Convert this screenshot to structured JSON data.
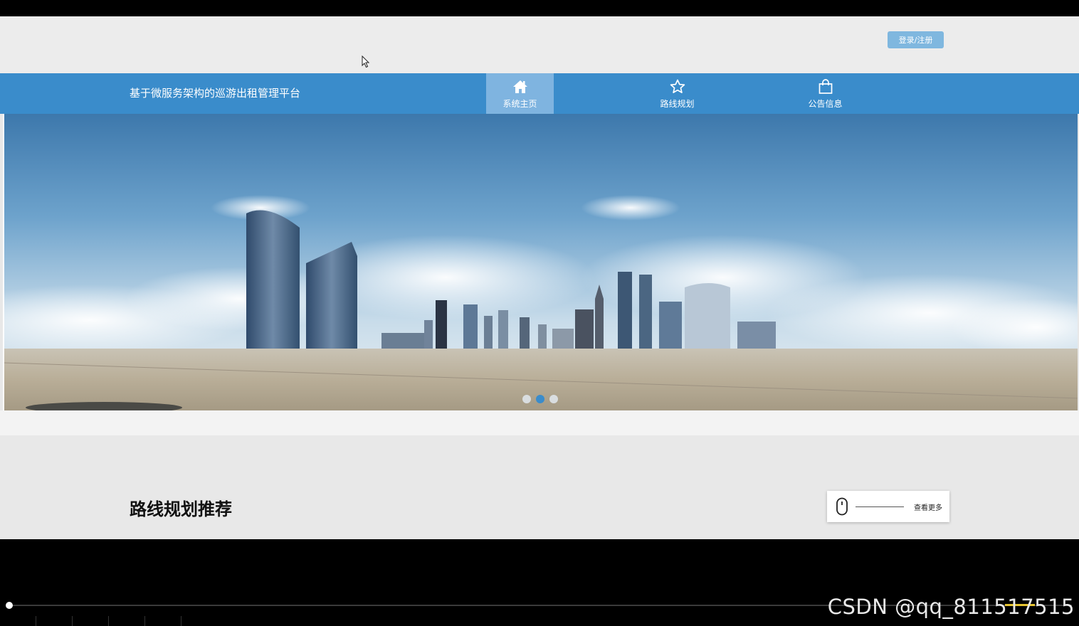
{
  "header": {
    "login_label": "登录/注册"
  },
  "navbar": {
    "title": "基于微服务架构的巡游出租管理平台",
    "items": [
      {
        "label": "系统主页",
        "icon": "home-icon",
        "active": true
      },
      {
        "label": "路线规划",
        "icon": "star-icon",
        "active": false
      },
      {
        "label": "公告信息",
        "icon": "shopping-bag-icon",
        "active": false
      }
    ]
  },
  "carousel": {
    "slide_count": 3,
    "active_index": 1
  },
  "section": {
    "title": "路线规划推荐",
    "more_label": "查看更多"
  },
  "watermark": "CSDN @qq_811517515",
  "colors": {
    "nav_blue": "#3a8ccb",
    "nav_active": "#7fb4e0",
    "login_button": "#7fb7df"
  }
}
